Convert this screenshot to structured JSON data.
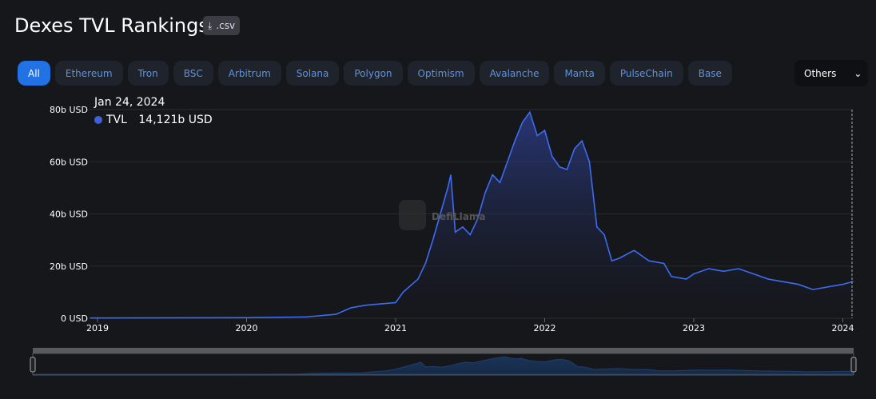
{
  "header": {
    "title": "Dexes TVL Rankings",
    "csv_label": ".csv"
  },
  "tabs": [
    {
      "label": "All"
    },
    {
      "label": "Ethereum"
    },
    {
      "label": "Tron"
    },
    {
      "label": "BSC"
    },
    {
      "label": "Arbitrum"
    },
    {
      "label": "Solana"
    },
    {
      "label": "Polygon"
    },
    {
      "label": "Optimism"
    },
    {
      "label": "Avalanche"
    },
    {
      "label": "Manta"
    },
    {
      "label": "PulseChain"
    },
    {
      "label": "Base"
    }
  ],
  "others_label": "Others",
  "tooltip": {
    "date": "Jan 24, 2024",
    "series": "TVL",
    "value": "14,121b USD"
  },
  "watermark": "DefiLlama",
  "colors": {
    "line": "#3d6cf0",
    "accent": "#2172e5"
  },
  "chart_data": {
    "type": "area",
    "title": "",
    "xlabel": "",
    "ylabel": "",
    "series": [
      {
        "name": "TVL",
        "x": [
          2018.95,
          2019,
          2020,
          2020.4,
          2020.6,
          2020.7,
          2020.8,
          2021.0,
          2021.05,
          2021.15,
          2021.2,
          2021.25,
          2021.3,
          2021.35,
          2021.37,
          2021.4,
          2021.45,
          2021.5,
          2021.55,
          2021.6,
          2021.65,
          2021.7,
          2021.75,
          2021.8,
          2021.85,
          2021.9,
          2021.95,
          2022.0,
          2022.05,
          2022.1,
          2022.15,
          2022.2,
          2022.25,
          2022.3,
          2022.35,
          2022.4,
          2022.45,
          2022.5,
          2022.6,
          2022.7,
          2022.8,
          2022.85,
          2022.95,
          2023.0,
          2023.1,
          2023.2,
          2023.3,
          2023.4,
          2023.5,
          2023.6,
          2023.7,
          2023.8,
          2023.9,
          2024.0,
          2024.07
        ],
        "values": [
          0.1,
          0.1,
          0.2,
          0.5,
          1.5,
          4,
          5,
          6,
          10,
          15,
          21,
          30,
          40,
          50,
          55,
          33,
          35,
          32,
          38,
          48,
          55,
          52,
          60,
          68,
          75,
          79,
          70,
          72,
          62,
          58,
          57,
          65,
          68,
          60,
          35,
          32,
          22,
          23,
          26,
          22,
          21,
          16,
          15,
          17,
          19,
          18,
          19,
          17,
          15,
          14,
          13,
          11,
          12,
          13,
          14.1
        ]
      }
    ],
    "yticks": [
      "0 USD",
      "20b USD",
      "40b USD",
      "60b USD",
      "80b USD"
    ],
    "ytick_values": [
      0,
      20,
      40,
      60,
      80
    ],
    "xticks": [
      "2019",
      "2020",
      "2021",
      "2022",
      "2023",
      "2024"
    ],
    "xtick_values": [
      2019,
      2020,
      2021,
      2022,
      2023,
      2024
    ],
    "ylim": [
      0,
      80
    ],
    "xlim": [
      2018.95,
      2024.07
    ],
    "grid": true
  }
}
